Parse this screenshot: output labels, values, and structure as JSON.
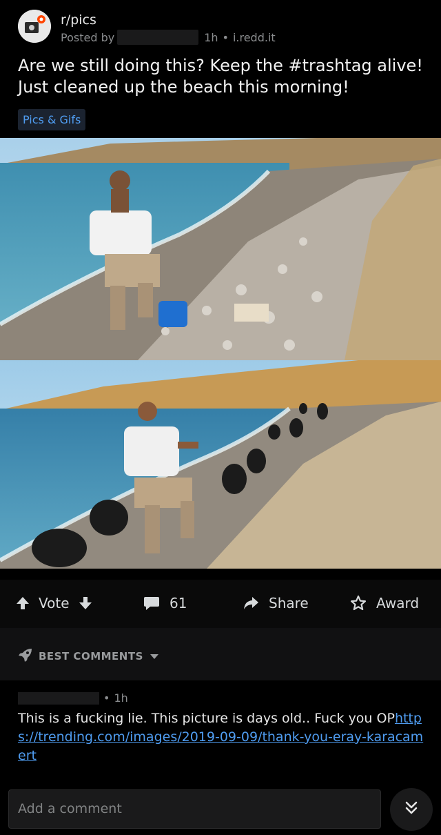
{
  "post": {
    "subreddit": "r/pics",
    "posted_by_prefix": "Posted by",
    "age": "1h",
    "separator": "•",
    "domain": "i.redd.it",
    "title": "Are we still doing this? Keep the #trashtag alive! Just cleaned up the beach this morning!",
    "flair": "Pics & Gifs"
  },
  "actions": {
    "vote_label": "Vote",
    "comment_count": "61",
    "share_label": "Share",
    "award_label": "Award"
  },
  "comments_section": {
    "sort_label": "BEST COMMENTS"
  },
  "comment": {
    "age": "1h",
    "separator": "•",
    "text": "This is a fucking lie. This picture is days old.. Fuck you OP",
    "link": "https://trending.com/images/2019-09-09/thank-you-eray-karacamert"
  },
  "composer": {
    "placeholder": "Add a comment"
  },
  "icons": {
    "upvote": "arrow-up-icon",
    "downvote": "arrow-down-icon",
    "comment": "comment-bubble-icon",
    "share": "share-arrow-icon",
    "award": "award-icon",
    "best": "rocket-icon",
    "sort": "caret-down-icon",
    "next": "double-chevron-down-icon"
  }
}
